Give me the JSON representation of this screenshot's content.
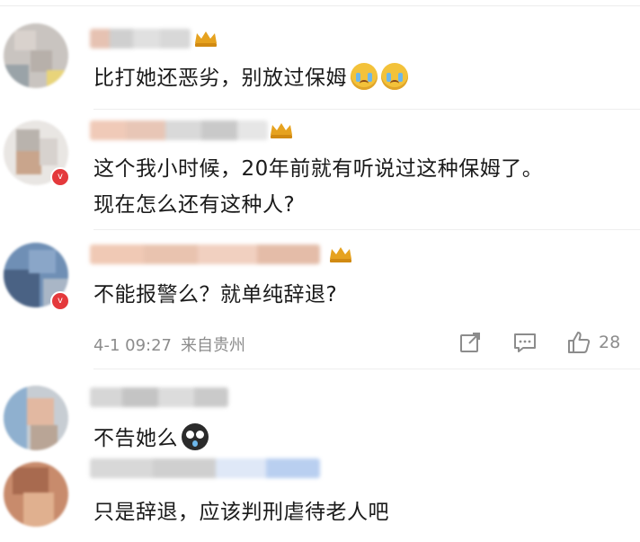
{
  "comments": [
    {
      "text": "比打她还恶劣，别放过保姆",
      "emojis": [
        "crying-face",
        "crying-face"
      ]
    },
    {
      "line1": "这个我小时候，20年前就有听说过这种保姆了。",
      "line2": "现在怎么还有这种人?"
    },
    {
      "text": "不能报警么？就单纯辞退?",
      "time": "4-1 09:27",
      "location": "来自贵州",
      "like_count": "28",
      "actions": [
        "share-icon",
        "comment-icon",
        "like-icon"
      ]
    },
    {
      "text": "不告她么",
      "emojis": [
        "dark-face"
      ]
    },
    {
      "text": "只是辞退，应该判刑虐待老人吧"
    }
  ],
  "colors": {
    "text": "#1a1a1a",
    "meta": "#8c8c8c",
    "verified_badge": "#e4393c",
    "crown": "#e6a21f"
  }
}
